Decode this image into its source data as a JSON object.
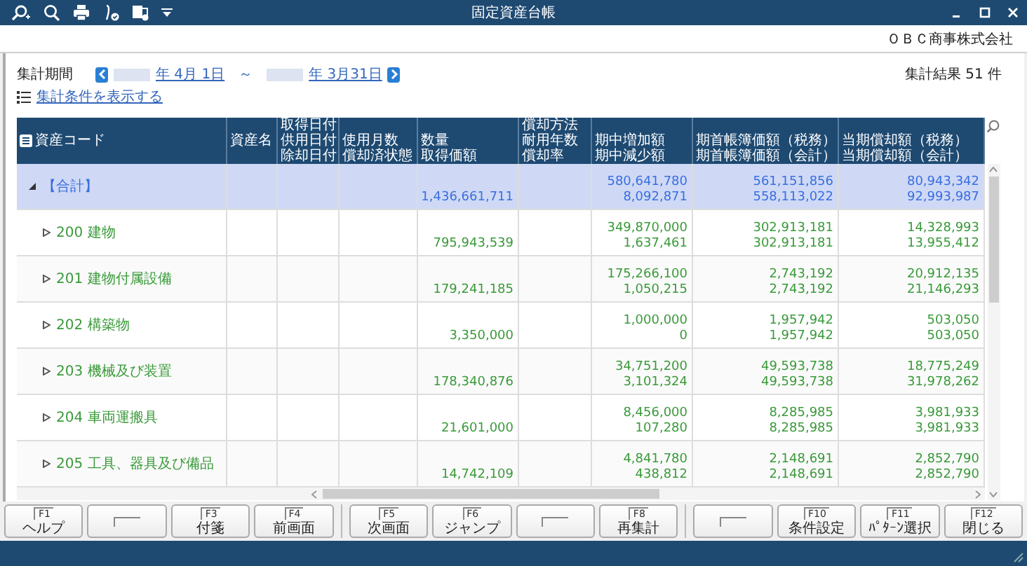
{
  "window": {
    "title": "固定資産台帳",
    "company": "ＯＢＣ商事株式会社"
  },
  "period": {
    "label": "集計期間",
    "start": "年 4月 1日",
    "separator": "～",
    "end": "年 3月31日"
  },
  "result_count": "集計結果 51 件",
  "conditions_link": "集計条件を表示する",
  "table": {
    "columns": [
      {
        "lines": [
          "資産コード"
        ]
      },
      {
        "lines": [
          "資産名"
        ]
      },
      {
        "lines": [
          "取得日付",
          "供用日付",
          "除却日付"
        ]
      },
      {
        "lines": [
          "使用月数",
          "償却済状態"
        ]
      },
      {
        "lines": [
          "数量",
          "取得価額"
        ]
      },
      {
        "lines": [
          "償却方法",
          "耐用年数",
          "償却率"
        ]
      },
      {
        "lines": [
          "期中増加額",
          "期中減少額"
        ]
      },
      {
        "lines": [
          "期首帳簿価額（税務）",
          "期首帳簿価額（会計）"
        ]
      },
      {
        "lines": [
          "当期償却額（税務）",
          "当期償却額（会計）"
        ]
      }
    ],
    "rows": [
      {
        "label": "【合計】",
        "kind": "total",
        "expanded": true,
        "selected": true,
        "acquisition": "1,436,661,711",
        "increase": "580,641,780",
        "decrease": "8,092,871",
        "opening_tax": "561,151,856",
        "opening_acct": "558,113,022",
        "dep_tax": "80,943,342",
        "dep_acct": "92,993,987",
        "children": [
          {
            "label": "200 建物",
            "kind": "group",
            "expanded": false,
            "selected": false,
            "acquisition": "795,943,539",
            "increase": "349,870,000",
            "decrease": "1,637,461",
            "opening_tax": "302,913,181",
            "opening_acct": "302,913,181",
            "dep_tax": "14,328,993",
            "dep_acct": "13,955,412"
          },
          {
            "label": "201 建物付属設備",
            "kind": "group",
            "expanded": false,
            "selected": false,
            "acquisition": "179,241,185",
            "increase": "175,266,100",
            "decrease": "1,050,215",
            "opening_tax": "2,743,192",
            "opening_acct": "2,743,192",
            "dep_tax": "20,912,135",
            "dep_acct": "21,146,293"
          },
          {
            "label": "202 構築物",
            "kind": "group",
            "expanded": false,
            "selected": false,
            "acquisition": "3,350,000",
            "increase": "1,000,000",
            "decrease": "0",
            "opening_tax": "1,957,942",
            "opening_acct": "1,957,942",
            "dep_tax": "503,050",
            "dep_acct": "503,050"
          },
          {
            "label": "203 機械及び装置",
            "kind": "group",
            "expanded": false,
            "selected": false,
            "acquisition": "178,340,876",
            "increase": "34,751,200",
            "decrease": "3,101,324",
            "opening_tax": "49,593,738",
            "opening_acct": "49,593,738",
            "dep_tax": "18,775,249",
            "dep_acct": "31,978,262"
          },
          {
            "label": "204 車両運搬具",
            "kind": "group",
            "expanded": false,
            "selected": false,
            "acquisition": "21,601,000",
            "increase": "8,456,000",
            "decrease": "107,280",
            "opening_tax": "8,285,985",
            "opening_acct": "8,285,985",
            "dep_tax": "3,981,933",
            "dep_acct": "3,981,933"
          },
          {
            "label": "205 工具、器具及び備品",
            "kind": "group",
            "expanded": false,
            "selected": false,
            "acquisition": "14,742,109",
            "increase": "4,841,780",
            "decrease": "438,812",
            "opening_tax": "2,148,691",
            "opening_acct": "2,148,691",
            "dep_tax": "2,852,790",
            "dep_acct": "2,852,790"
          }
        ]
      }
    ]
  },
  "function_keys": [
    {
      "kind": "key",
      "key": "F1",
      "label": "ヘルプ"
    },
    {
      "kind": "empty"
    },
    {
      "kind": "key",
      "key": "F3",
      "label": "付箋"
    },
    {
      "kind": "key",
      "key": "F4",
      "label": "前画面"
    },
    {
      "kind": "key",
      "key": "F5",
      "label": "次画面"
    },
    {
      "kind": "key",
      "key": "F6",
      "label": "ジャンプ"
    },
    {
      "kind": "empty"
    },
    {
      "kind": "key",
      "key": "F8",
      "label": "再集計"
    },
    {
      "kind": "empty"
    },
    {
      "kind": "key",
      "key": "F10",
      "label": "条件設定"
    },
    {
      "kind": "key",
      "key": "F11",
      "label": "ﾊﾟﾀｰﾝ選択"
    },
    {
      "kind": "key",
      "key": "F12",
      "label": "閉じる"
    }
  ]
}
